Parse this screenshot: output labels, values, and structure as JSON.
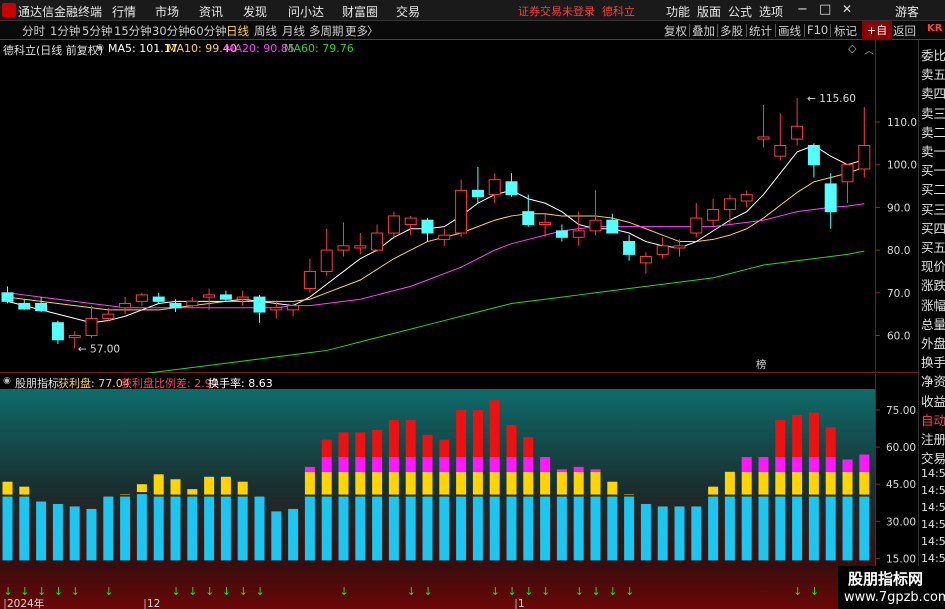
{
  "titlebar": {
    "app_name": "通达信金融终端",
    "menus": [
      "行情",
      "市场",
      "资讯",
      "发现",
      "问小达",
      "财富圈",
      "交易"
    ],
    "warning": "证券交易未登录",
    "stock_name": "德科立",
    "right_menus": [
      "功能",
      "版面",
      "公式",
      "选项"
    ],
    "user": "游客",
    "win_min": "−",
    "win_max": "□",
    "win_close": "✕"
  },
  "toolbar": {
    "periods": [
      "分时",
      "1分钟",
      "5分钟",
      "15分钟",
      "30分钟",
      "60分钟",
      "日线",
      "周线",
      "月线",
      "多周期",
      "更多"
    ],
    "active_period": "日线",
    "more_arrow": "〉",
    "tools": [
      "复权",
      "叠加",
      "多股",
      "统计",
      "画线",
      "F10",
      "标记",
      "+自选",
      "返回"
    ],
    "active_tool": "+自选"
  },
  "info": {
    "title": "德科立(日线 前复权)",
    "ma5": "MA5: 101.17",
    "ma10": "MA10: 99.40",
    "ma20": "MA20: 90.85",
    "ma60": "MA60: 79.76",
    "ma5_color": "#ffffff",
    "ma10_color": "#ffd24a",
    "ma20_color": "#ff40ff",
    "ma60_color": "#30d030"
  },
  "indicator": {
    "name": "股朋指标",
    "field1": "获利盘: 77.04",
    "field2": "获利盘比例差: 2.92",
    "field3": "换手率: 8.63",
    "field1_color": "#ffd24a",
    "field2_color": "#ff4060",
    "field3_color": "#ffffff"
  },
  "price_axis": [
    "110.0",
    "100.0",
    "90.0",
    "80.0",
    "70.0",
    "60.0",
    "50.0"
  ],
  "ind_axis": [
    "75.00",
    "60.00",
    "45.00",
    "30.00",
    "15.00"
  ],
  "annotations": {
    "high": "115.60",
    "low": "57.00",
    "marker": "榜"
  },
  "time_labels": [
    "2024年",
    "12",
    "1"
  ],
  "right_panel": [
    "委比",
    "卖五",
    "卖四",
    "卖三",
    "卖二",
    "卖一",
    "买一",
    "买二",
    "买三",
    "买四",
    "买五",
    "现价",
    "涨跌",
    "涨幅",
    "总量",
    "外盘",
    "换手",
    "净资",
    "收益",
    "自动",
    "注册",
    "交易",
    "14:56",
    "14:56",
    "14:56",
    "14:56",
    "14:56",
    "14:56",
    "14:56",
    "14:56"
  ],
  "right_panel_tag": "KR",
  "watermark": {
    "line1": "股朋指标网",
    "line2": "www.7gpzb.com"
  },
  "chart_data": [
    {
      "type": "candlestick",
      "title": "德科立(日线 前复权)",
      "ylim": [
        45,
        120
      ],
      "candles": [
        [
          70.0,
          71.5,
          67.5,
          68.0
        ],
        [
          67.5,
          68.5,
          66.0,
          66.2
        ],
        [
          67.5,
          69.0,
          65.5,
          65.8
        ],
        [
          63.0,
          63.5,
          58.0,
          59.0
        ],
        [
          59.5,
          61.0,
          57.0,
          60.0
        ],
        [
          60.0,
          67.0,
          59.5,
          64.0
        ],
        [
          64.0,
          66.5,
          63.5,
          65.0
        ],
        [
          66.5,
          69.0,
          65.0,
          67.5
        ],
        [
          68.0,
          70.0,
          67.0,
          69.5
        ],
        [
          69.0,
          70.0,
          67.5,
          68.0
        ],
        [
          67.5,
          68.5,
          65.5,
          66.5
        ],
        [
          67.0,
          69.0,
          66.5,
          68.0
        ],
        [
          69.0,
          71.0,
          66.0,
          69.5
        ],
        [
          69.5,
          70.5,
          68.0,
          68.5
        ],
        [
          68.5,
          70.5,
          67.0,
          69.0
        ],
        [
          69.0,
          69.5,
          63.0,
          65.5
        ],
        [
          66.0,
          68.0,
          64.0,
          66.5
        ],
        [
          66.0,
          67.5,
          64.5,
          67.0
        ],
        [
          71.0,
          78.0,
          70.0,
          75.0
        ],
        [
          75.0,
          85.0,
          74.0,
          80.0
        ],
        [
          80.0,
          86.5,
          78.5,
          81.0
        ],
        [
          80.5,
          84.0,
          79.0,
          81.0
        ],
        [
          80.0,
          86.0,
          79.5,
          84.0
        ],
        [
          84.0,
          89.0,
          83.0,
          88.0
        ],
        [
          86.0,
          88.0,
          83.5,
          87.5
        ],
        [
          87.0,
          87.5,
          82.0,
          84.0
        ],
        [
          82.5,
          85.0,
          81.0,
          83.5
        ],
        [
          84.0,
          96.5,
          83.0,
          94.0
        ],
        [
          94.0,
          99.5,
          91.0,
          92.5
        ],
        [
          93.0,
          98.0,
          91.0,
          96.5
        ],
        [
          96.0,
          98.0,
          92.5,
          93.0
        ],
        [
          89.0,
          93.0,
          85.5,
          86.0
        ],
        [
          86.0,
          88.5,
          83.0,
          86.5
        ],
        [
          84.5,
          86.0,
          82.0,
          83.0
        ],
        [
          83.0,
          89.0,
          81.0,
          84.5
        ],
        [
          84.5,
          94.0,
          83.5,
          87.0
        ],
        [
          87.0,
          88.5,
          84.0,
          84.0
        ],
        [
          82.0,
          83.5,
          77.5,
          79.0
        ],
        [
          77.0,
          79.5,
          74.5,
          78.5
        ],
        [
          79.0,
          83.0,
          78.0,
          81.0
        ],
        [
          80.5,
          82.5,
          78.5,
          81.0
        ],
        [
          84.0,
          91.0,
          83.0,
          87.5
        ],
        [
          87.0,
          92.0,
          85.5,
          89.5
        ],
        [
          89.5,
          93.0,
          86.0,
          92.0
        ],
        [
          91.5,
          94.0,
          90.0,
          93.0
        ],
        [
          106.0,
          114.0,
          104.0,
          106.5
        ],
        [
          102.0,
          112.0,
          101.0,
          104.5
        ],
        [
          106.0,
          115.6,
          104.5,
          109.0
        ],
        [
          104.5,
          105.0,
          97.0,
          100.0
        ],
        [
          95.5,
          98.0,
          85.0,
          89.0
        ],
        [
          96.0,
          99.0,
          91.0,
          100.0
        ],
        [
          99.0,
          113.5,
          97.0,
          104.5
        ]
      ],
      "ma_lines": {
        "MA5": [
          68.0,
          67.0,
          66.0,
          65.0,
          64.0,
          63.0,
          63.5,
          64.5,
          66.0,
          67.5,
          68.0,
          68.0,
          68.0,
          68.0,
          68.5,
          68.0,
          67.5,
          67.0,
          69.0,
          72.0,
          75.0,
          78.0,
          80.0,
          83.0,
          85.0,
          85.0,
          85.5,
          88.0,
          91.0,
          93.0,
          94.0,
          92.0,
          91.0,
          89.0,
          86.0,
          85.0,
          85.0,
          84.0,
          82.0,
          81.0,
          80.5,
          82.0,
          84.5,
          87.0,
          89.0,
          93.0,
          98.0,
          103.0,
          104.5,
          102.0,
          100.0,
          101.17
        ],
        "MA10": [
          69.0,
          68.5,
          68.0,
          67.5,
          67.0,
          66.5,
          66.0,
          66.0,
          66.0,
          66.0,
          66.5,
          67.0,
          67.5,
          68.0,
          68.0,
          68.0,
          68.0,
          68.0,
          68.5,
          70.0,
          71.5,
          73.0,
          75.5,
          78.0,
          80.0,
          82.0,
          83.0,
          84.0,
          85.5,
          87.0,
          88.0,
          88.5,
          88.5,
          88.0,
          88.0,
          88.0,
          87.5,
          86.5,
          85.0,
          83.5,
          82.0,
          82.0,
          82.5,
          83.5,
          85.0,
          87.5,
          90.5,
          93.5,
          96.0,
          97.0,
          98.0,
          99.4
        ],
        "MA20": [
          70.0,
          69.5,
          69.0,
          68.5,
          68.0,
          67.5,
          67.0,
          66.5,
          66.5,
          66.5,
          66.5,
          66.5,
          66.5,
          66.5,
          66.5,
          66.5,
          66.5,
          67.0,
          67.0,
          67.5,
          68.0,
          68.5,
          69.5,
          70.5,
          71.5,
          73.0,
          74.5,
          76.0,
          78.0,
          80.0,
          81.5,
          82.5,
          83.5,
          84.5,
          85.0,
          85.5,
          85.5,
          85.5,
          85.5,
          85.5,
          85.5,
          85.5,
          85.5,
          86.0,
          86.5,
          87.0,
          88.0,
          89.0,
          89.5,
          90.0,
          90.3,
          90.85
        ],
        "MA60": [
          47.0,
          47.5,
          48.0,
          48.5,
          49.0,
          49.5,
          50.0,
          50.5,
          51.0,
          51.5,
          52.0,
          52.5,
          53.0,
          53.5,
          54.0,
          54.5,
          55.0,
          55.5,
          56.0,
          56.5,
          57.5,
          58.5,
          59.5,
          60.5,
          61.5,
          62.5,
          63.5,
          64.5,
          65.5,
          66.5,
          67.5,
          68.0,
          68.5,
          69.0,
          69.5,
          70.0,
          70.5,
          71.0,
          71.5,
          72.0,
          72.5,
          73.0,
          73.5,
          74.5,
          75.5,
          76.5,
          77.0,
          77.5,
          78.0,
          78.5,
          79.0,
          79.76
        ]
      }
    },
    {
      "type": "bar",
      "title": "股朋指标",
      "ylim": [
        15,
        82
      ],
      "cyan": [
        40,
        40,
        38,
        37,
        36,
        35,
        40,
        40,
        41,
        40,
        40,
        40,
        40,
        40,
        40,
        40,
        34,
        35,
        40,
        40,
        40,
        40,
        40,
        40,
        40,
        40,
        40,
        40,
        40,
        40,
        40,
        40,
        40,
        40,
        40,
        40,
        40,
        40,
        37,
        36,
        36,
        36,
        40,
        40,
        40,
        40,
        40,
        40,
        40,
        40,
        40,
        40
      ],
      "yellow": [
        46,
        44,
        0,
        0,
        0,
        0,
        0,
        41,
        45,
        49,
        47,
        43,
        48,
        48,
        46,
        0,
        0,
        0,
        50,
        50,
        50,
        50,
        50,
        50,
        50,
        50,
        50,
        50,
        50,
        50,
        50,
        50,
        50,
        50,
        50,
        50,
        46,
        41,
        0,
        0,
        0,
        0,
        44,
        50,
        50,
        50,
        50,
        50,
        50,
        50,
        50,
        50
      ],
      "magenta": [
        0,
        0,
        0,
        0,
        0,
        0,
        0,
        0,
        0,
        0,
        0,
        0,
        0,
        0,
        0,
        0,
        0,
        0,
        52,
        56,
        56,
        56,
        56,
        56,
        56,
        56,
        56,
        56,
        56,
        56,
        56,
        56,
        56,
        51,
        52,
        51,
        0,
        0,
        0,
        0,
        0,
        0,
        0,
        0,
        56,
        56,
        56,
        56,
        56,
        56,
        55,
        57
      ],
      "red": [
        0,
        0,
        0,
        0,
        0,
        0,
        0,
        0,
        0,
        0,
        0,
        0,
        0,
        0,
        0,
        0,
        0,
        0,
        0,
        63,
        66,
        66,
        67,
        71,
        71,
        65,
        63,
        75,
        75,
        79,
        69,
        64,
        0,
        0,
        0,
        0,
        0,
        0,
        0,
        0,
        0,
        0,
        0,
        0,
        0,
        0,
        71,
        73,
        74,
        68,
        0,
        0
      ]
    }
  ]
}
